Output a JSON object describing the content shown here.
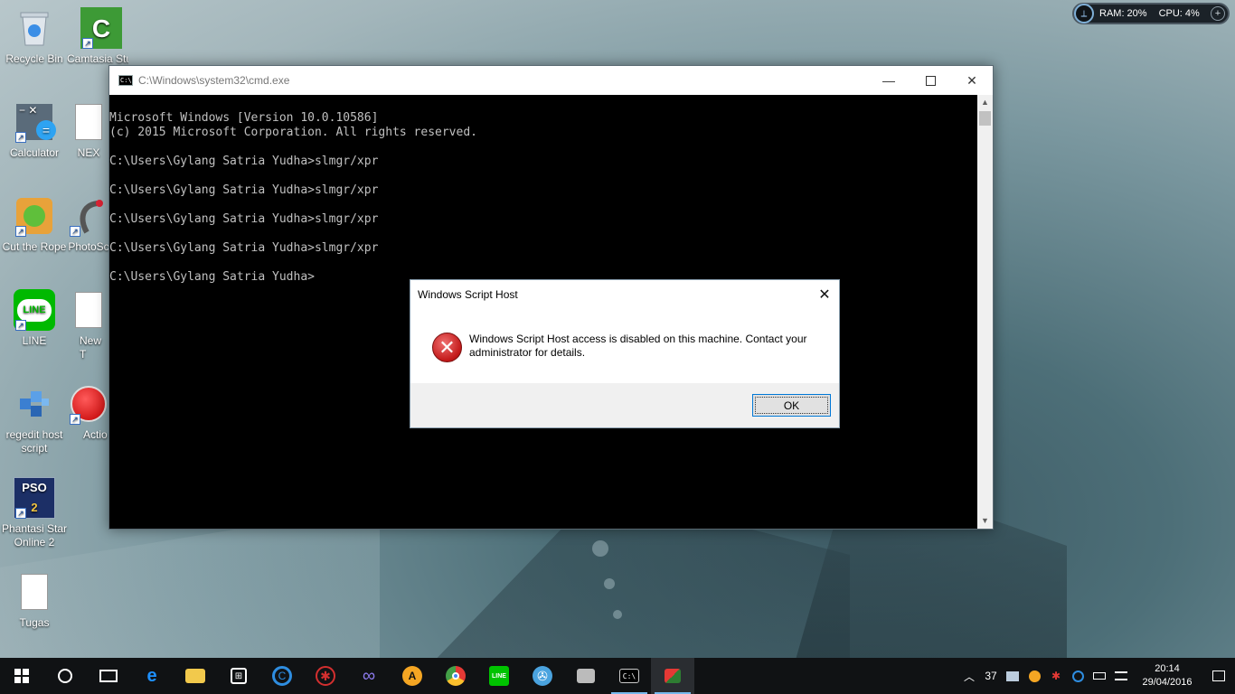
{
  "desktop": {
    "icons": [
      {
        "label": "Recycle Bin",
        "icon": "recycle-bin-icon"
      },
      {
        "label": "Camtasia Studio",
        "icon": "camtasia-icon"
      },
      {
        "label": "Calculator",
        "icon": "calculator-icon"
      },
      {
        "label": "NEX",
        "icon": "document-icon"
      },
      {
        "label": "Cut the Rope",
        "icon": "cut-the-rope-icon"
      },
      {
        "label": "PhotoSc",
        "icon": "photoscape-icon"
      },
      {
        "label": "LINE",
        "icon": "line-icon"
      },
      {
        "label": "New T Docum",
        "icon": "text-document-icon"
      },
      {
        "label": "regedit host script",
        "icon": "registry-icon"
      },
      {
        "label": "Actio",
        "icon": "record-icon"
      },
      {
        "label": "Phantasi Star Online 2",
        "icon": "pso2-icon"
      },
      {
        "label": "Tugas",
        "icon": "document-icon"
      }
    ]
  },
  "monitor": {
    "ram": "RAM: 20%",
    "cpu": "CPU: 4%"
  },
  "cmd": {
    "title": "C:\\Windows\\system32\\cmd.exe",
    "lines": [
      "Microsoft Windows [Version 10.0.10586]",
      "(c) 2015 Microsoft Corporation. All rights reserved.",
      "",
      "C:\\Users\\Gylang Satria Yudha>slmgr/xpr",
      "",
      "C:\\Users\\Gylang Satria Yudha>slmgr/xpr",
      "",
      "C:\\Users\\Gylang Satria Yudha>slmgr/xpr",
      "",
      "C:\\Users\\Gylang Satria Yudha>slmgr/xpr",
      "",
      "C:\\Users\\Gylang Satria Yudha>"
    ]
  },
  "dialog": {
    "title": "Windows Script Host",
    "message": "Windows Script Host access is disabled on this machine. Contact your administrator for details.",
    "ok_label": "OK"
  },
  "taskbar": {
    "apps": [
      {
        "name": "edge",
        "icon": "edge-icon",
        "color": "#1e90ff"
      },
      {
        "name": "file-explorer",
        "icon": "folder-icon",
        "color": "#f2c94c"
      },
      {
        "name": "store",
        "icon": "store-icon",
        "color": "#ffffff"
      },
      {
        "name": "app-blue",
        "icon": "ccleaner-icon",
        "color": "#2e8de0"
      },
      {
        "name": "app-red",
        "icon": "red-app-icon",
        "color": "#d32f2f"
      },
      {
        "name": "app-infinity",
        "icon": "infinity-icon",
        "color": "#8e7cf0"
      },
      {
        "name": "app-avast",
        "icon": "avast-icon",
        "color": "#f5a623"
      },
      {
        "name": "chrome",
        "icon": "chrome-icon",
        "color": "#e53935"
      },
      {
        "name": "line",
        "icon": "line-icon",
        "color": "#00c300"
      },
      {
        "name": "media",
        "icon": "film-reel-icon",
        "color": "#4aa3df"
      },
      {
        "name": "photos",
        "icon": "photos-icon",
        "color": "#bbbbbb"
      },
      {
        "name": "cmd",
        "icon": "cmd-icon",
        "color": "#cccccc"
      },
      {
        "name": "wsh",
        "icon": "script-host-icon",
        "color": "#e53935"
      }
    ],
    "tray_count": "37",
    "time": "20:14",
    "date": "29/04/2016"
  }
}
